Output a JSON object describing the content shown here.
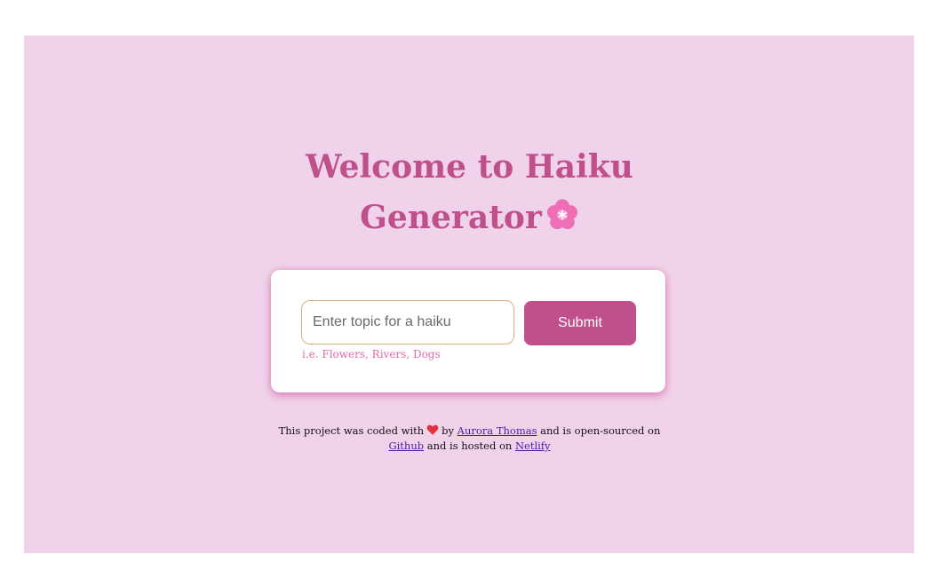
{
  "header": {
    "title_line1": "Welcome to Haiku",
    "title_line2": "Generator"
  },
  "form": {
    "input_value": "",
    "input_placeholder": "Enter topic for a haiku",
    "hint": "i.e. Flowers, Rivers, Dogs",
    "submit_label": "Submit"
  },
  "footer": {
    "text_before_heart": "This project was coded with",
    "text_by": "by",
    "author_link": "Aurora Thomas",
    "text_open_sourced": "and is open-sourced on",
    "github_link": "Github",
    "text_hosted": "and is hosted on",
    "netlify_link": "Netlify"
  },
  "icons": {
    "title_icon": "cherry-blossom-icon",
    "footer_icon": "heart-icon"
  },
  "colors": {
    "background": "#f0d3ea",
    "accent": "#c0508c",
    "hint": "#e06aa9",
    "link": "#4b1aa6",
    "heart": "#e0323a"
  }
}
